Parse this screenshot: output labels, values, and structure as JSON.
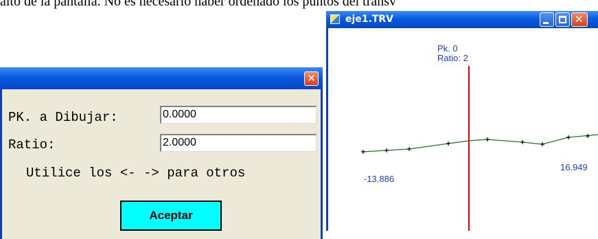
{
  "doc_text": "alto de la pantalla. No es necesario haber ordenado los puntos del transv",
  "dialog": {
    "close_glyph": "✕",
    "pk_label": "PK. a Dibujar:",
    "pk_value": "0.0000",
    "ratio_label": "Ratio:",
    "ratio_value": "2.0000",
    "hint": "Utilice los <- -> para otros",
    "ok_label": "Aceptar"
  },
  "window": {
    "title": "eje1.TRV",
    "buttons": {
      "minimize": "minimize-icon",
      "maximize": "maximize-icon",
      "close": "close-icon"
    }
  },
  "plot": {
    "pk_text": "Pk. 0",
    "ratio_text": "Ratio: 2",
    "left_value": "-13.886",
    "right_value": "16.949",
    "colors": {
      "axis": "#e0000a",
      "profile": "#1c7a1c",
      "labels": "#1f3ec2"
    }
  }
}
